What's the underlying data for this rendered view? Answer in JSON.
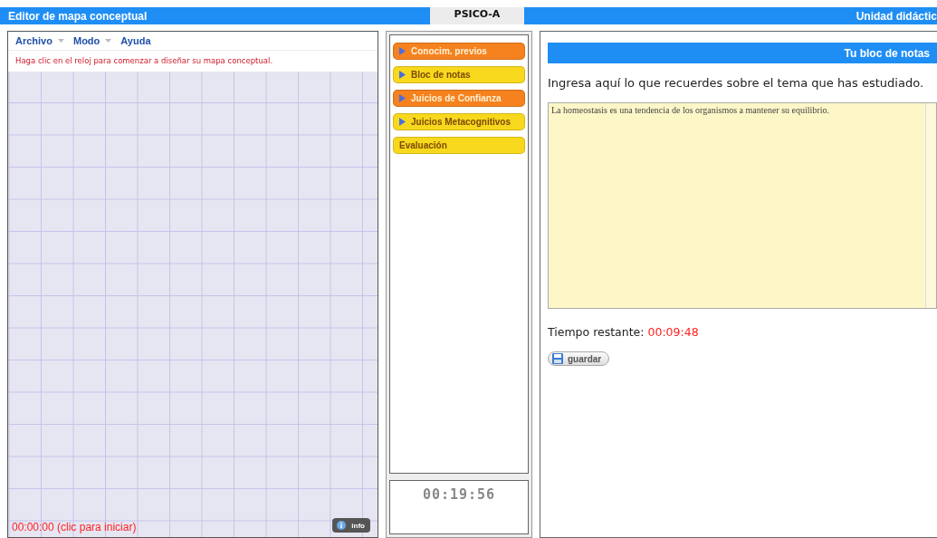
{
  "header": {
    "left_title": "Editor de mapa conceptual",
    "center_tab": "PSICO-A",
    "right_title": "Unidad didáctic"
  },
  "editor": {
    "menu": [
      {
        "label": "Archivo",
        "dropdown": true
      },
      {
        "label": "Modo",
        "dropdown": true
      },
      {
        "label": "Ayuda",
        "dropdown": false
      }
    ],
    "hint": "Haga clic en el reloj para comenzar a diseñar su mapa conceptual.",
    "clock": "00:00:00 (clic para iniciar)",
    "info_button": "info"
  },
  "nav": {
    "items": [
      {
        "label": "Conocim. previos",
        "color": "#f5821f",
        "arrow": true
      },
      {
        "label": "Bloc de notas",
        "color": "#f8d81c",
        "arrow": true
      },
      {
        "label": "Juicios de Confianza",
        "color": "#f5821f",
        "arrow": true
      },
      {
        "label": "Juicios Metacognitivos",
        "color": "#f8d81c",
        "arrow": true
      },
      {
        "label": "Evaluación",
        "color": "#f8d81c",
        "arrow": false
      }
    ],
    "timer": "00:19:56"
  },
  "notepad": {
    "title": "Tu bloc de notas",
    "prompt": "Ingresa aquí lo que recuerdes sobre el tema que has estudiado.",
    "text": "La homeostasis es una tendencia de los organismos a mantener su equilibrio.",
    "remaining_label": "Tiempo restante:",
    "remaining": "00:09:48",
    "save_button": "guardar"
  }
}
